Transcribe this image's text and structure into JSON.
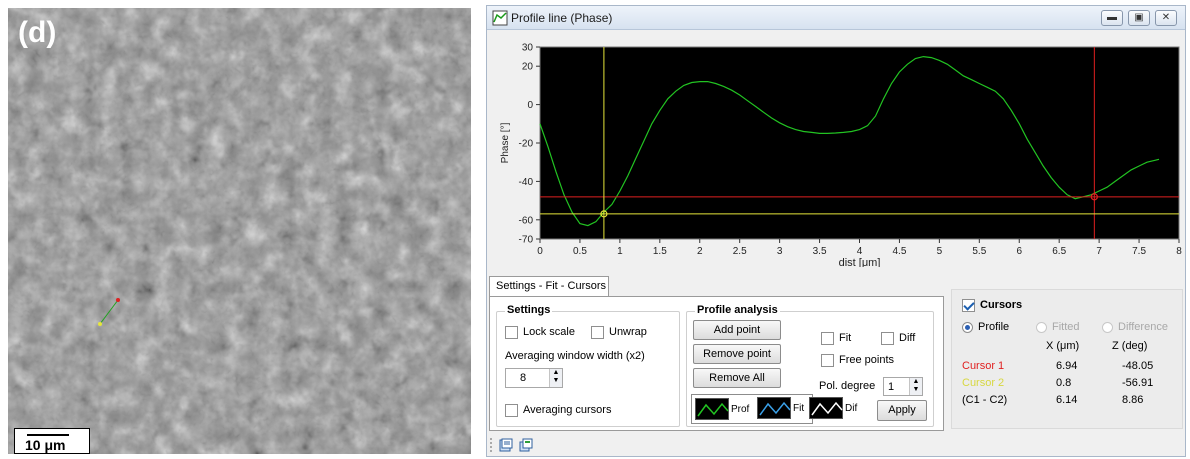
{
  "micrograph": {
    "panel_label": "(d)",
    "scale_bar": "10 μm"
  },
  "window": {
    "title": "Profile line (Phase)",
    "controls": [
      "minimize",
      "restore",
      "close"
    ]
  },
  "chart_data": {
    "type": "line",
    "xlabel": "dist [μm]",
    "ylabel": "Phase [°]",
    "xlim": [
      0,
      8
    ],
    "ylim": [
      -70,
      30
    ],
    "xticks": [
      0,
      0.5,
      1,
      1.5,
      2,
      2.5,
      3,
      3.5,
      4,
      4.5,
      5,
      5.5,
      6,
      6.5,
      7,
      7.5,
      8
    ],
    "yticks": [
      30,
      20,
      0,
      -20,
      -40,
      -60,
      -70
    ],
    "background": "#000000",
    "series": [
      {
        "color": "#22c322",
        "x": [
          0,
          0.1,
          0.2,
          0.3,
          0.4,
          0.5,
          0.6,
          0.7,
          0.8,
          0.9,
          1.0,
          1.1,
          1.2,
          1.3,
          1.4,
          1.5,
          1.6,
          1.7,
          1.8,
          1.9,
          2.0,
          2.1,
          2.2,
          2.3,
          2.4,
          2.5,
          2.6,
          2.7,
          2.8,
          2.9,
          3.0,
          3.1,
          3.2,
          3.3,
          3.4,
          3.5,
          3.6,
          3.7,
          3.8,
          3.9,
          4.0,
          4.1,
          4.2,
          4.3,
          4.4,
          4.5,
          4.6,
          4.7,
          4.8,
          4.9,
          5.0,
          5.1,
          5.2,
          5.3,
          5.4,
          5.5,
          5.6,
          5.7,
          5.8,
          5.9,
          6.0,
          6.1,
          6.2,
          6.3,
          6.4,
          6.5,
          6.6,
          6.7,
          6.8,
          6.9,
          7.0,
          7.1,
          7.2,
          7.3,
          7.4,
          7.5,
          7.6,
          7.7,
          7.75
        ],
        "y": [
          -10,
          -22,
          -35,
          -47,
          -56,
          -62,
          -63,
          -61,
          -56,
          -52,
          -45,
          -37,
          -28,
          -19,
          -10,
          -3,
          3,
          7,
          10,
          11.5,
          12,
          12,
          11,
          9.5,
          7.5,
          5,
          2,
          -1,
          -4,
          -7,
          -9.5,
          -11.5,
          -13,
          -14,
          -14.5,
          -15,
          -15,
          -14.8,
          -14.5,
          -14,
          -13,
          -11,
          -6,
          3,
          11,
          17,
          21,
          24,
          25,
          24.5,
          23,
          21,
          18,
          15,
          13,
          11,
          9,
          7,
          3,
          -3,
          -10,
          -18,
          -25,
          -32,
          -38,
          -43,
          -47,
          -49,
          -48,
          -47,
          -45,
          -43,
          -40,
          -37,
          -34,
          -32,
          -30,
          -29,
          -28.5
        ]
      }
    ],
    "cursors": [
      {
        "name": "Cursor 1",
        "x": 6.94,
        "y": -48.05,
        "color": "#e02020"
      },
      {
        "name": "Cursor 2",
        "x": 0.8,
        "y": -56.91,
        "color": "#e6e63a"
      }
    ]
  },
  "tabs": {
    "active": "Settings - Fit - Cursors"
  },
  "settings": {
    "title": "Settings",
    "lock_scale": "Lock scale",
    "unwrap": "Unwrap",
    "averaging_window_label": "Averaging window width (x2)",
    "averaging_window_value": "8",
    "averaging_cursors": "Averaging cursors"
  },
  "profile_analysis": {
    "title": "Profile analysis",
    "add_point": "Add point",
    "remove_point": "Remove point",
    "remove_all": "Remove All",
    "fit": "Fit",
    "diff": "Diff",
    "free_points": "Free points",
    "pol_degree_label": "Pol. degree",
    "pol_degree_value": "1",
    "apply": "Apply",
    "legend": [
      "Prof",
      "Fit",
      "Dif"
    ]
  },
  "cursors_panel": {
    "title": "Cursors",
    "modes": [
      "Profile",
      "Fitted",
      "Difference"
    ],
    "col_x": "X (μm)",
    "col_z": "Z (deg)",
    "rows": [
      {
        "label": "Cursor 1",
        "x": "6.94",
        "z": "-48.05",
        "color": "#e02020"
      },
      {
        "label": "Cursor 2",
        "x": "0.8",
        "z": "-56.91",
        "color": "#d8d840"
      },
      {
        "label": "(C1 - C2)",
        "x": "6.14",
        "z": "8.86",
        "color": "#000000"
      }
    ]
  }
}
